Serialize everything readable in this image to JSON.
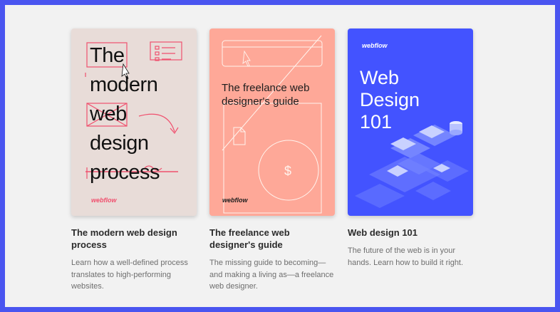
{
  "cards": [
    {
      "cover_title_lines": [
        "The",
        "modern",
        "web",
        "design",
        "process"
      ],
      "cover_brand": "webflow",
      "title": "The modern web design process",
      "description": "Learn how a well-defined process translates to high-performing websites."
    },
    {
      "cover_title": "The freelance web designer's guide",
      "cover_symbol": "$",
      "cover_brand": "webflow",
      "title": "The freelance web designer's guide",
      "description": "The missing guide to becoming—and making a living as—a freelance web designer."
    },
    {
      "cover_brand": "webflow",
      "cover_title": "Web Design 101",
      "title": "Web design 101",
      "description": "The future of the web is in your hands. Learn how to build it right."
    }
  ],
  "colors": {
    "frame_border": "#4a55f0",
    "background": "#f2f2f2",
    "cover1": "#e8dcd8",
    "cover2": "#fea898",
    "cover3": "#4353ff",
    "accent_pink": "#f0506e"
  }
}
